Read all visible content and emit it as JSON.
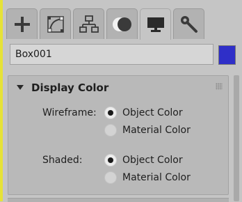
{
  "tabs": [
    {
      "id": "create",
      "icon": "plus-icon",
      "active": false
    },
    {
      "id": "modify",
      "icon": "bezier-curve-icon",
      "active": false
    },
    {
      "id": "hierarchy",
      "icon": "hierarchy-icon",
      "active": false
    },
    {
      "id": "motion",
      "icon": "motion-circles-icon",
      "active": false
    },
    {
      "id": "display",
      "icon": "monitor-icon",
      "active": true
    },
    {
      "id": "utilities",
      "icon": "wrench-icon",
      "active": false
    }
  ],
  "object": {
    "name": "Box001",
    "color": "#2f2fc8"
  },
  "rollout": {
    "title": "Display Color",
    "wireframe": {
      "label": "Wireframe:",
      "options": [
        "Object Color",
        "Material Color"
      ],
      "selected": "Object Color"
    },
    "shaded": {
      "label": "Shaded:",
      "options": [
        "Object Color",
        "Material Color"
      ],
      "selected": "Object Color"
    }
  },
  "colors": {
    "accent_stripe": "#e6e237",
    "panel_bg": "#c5c5c5"
  }
}
